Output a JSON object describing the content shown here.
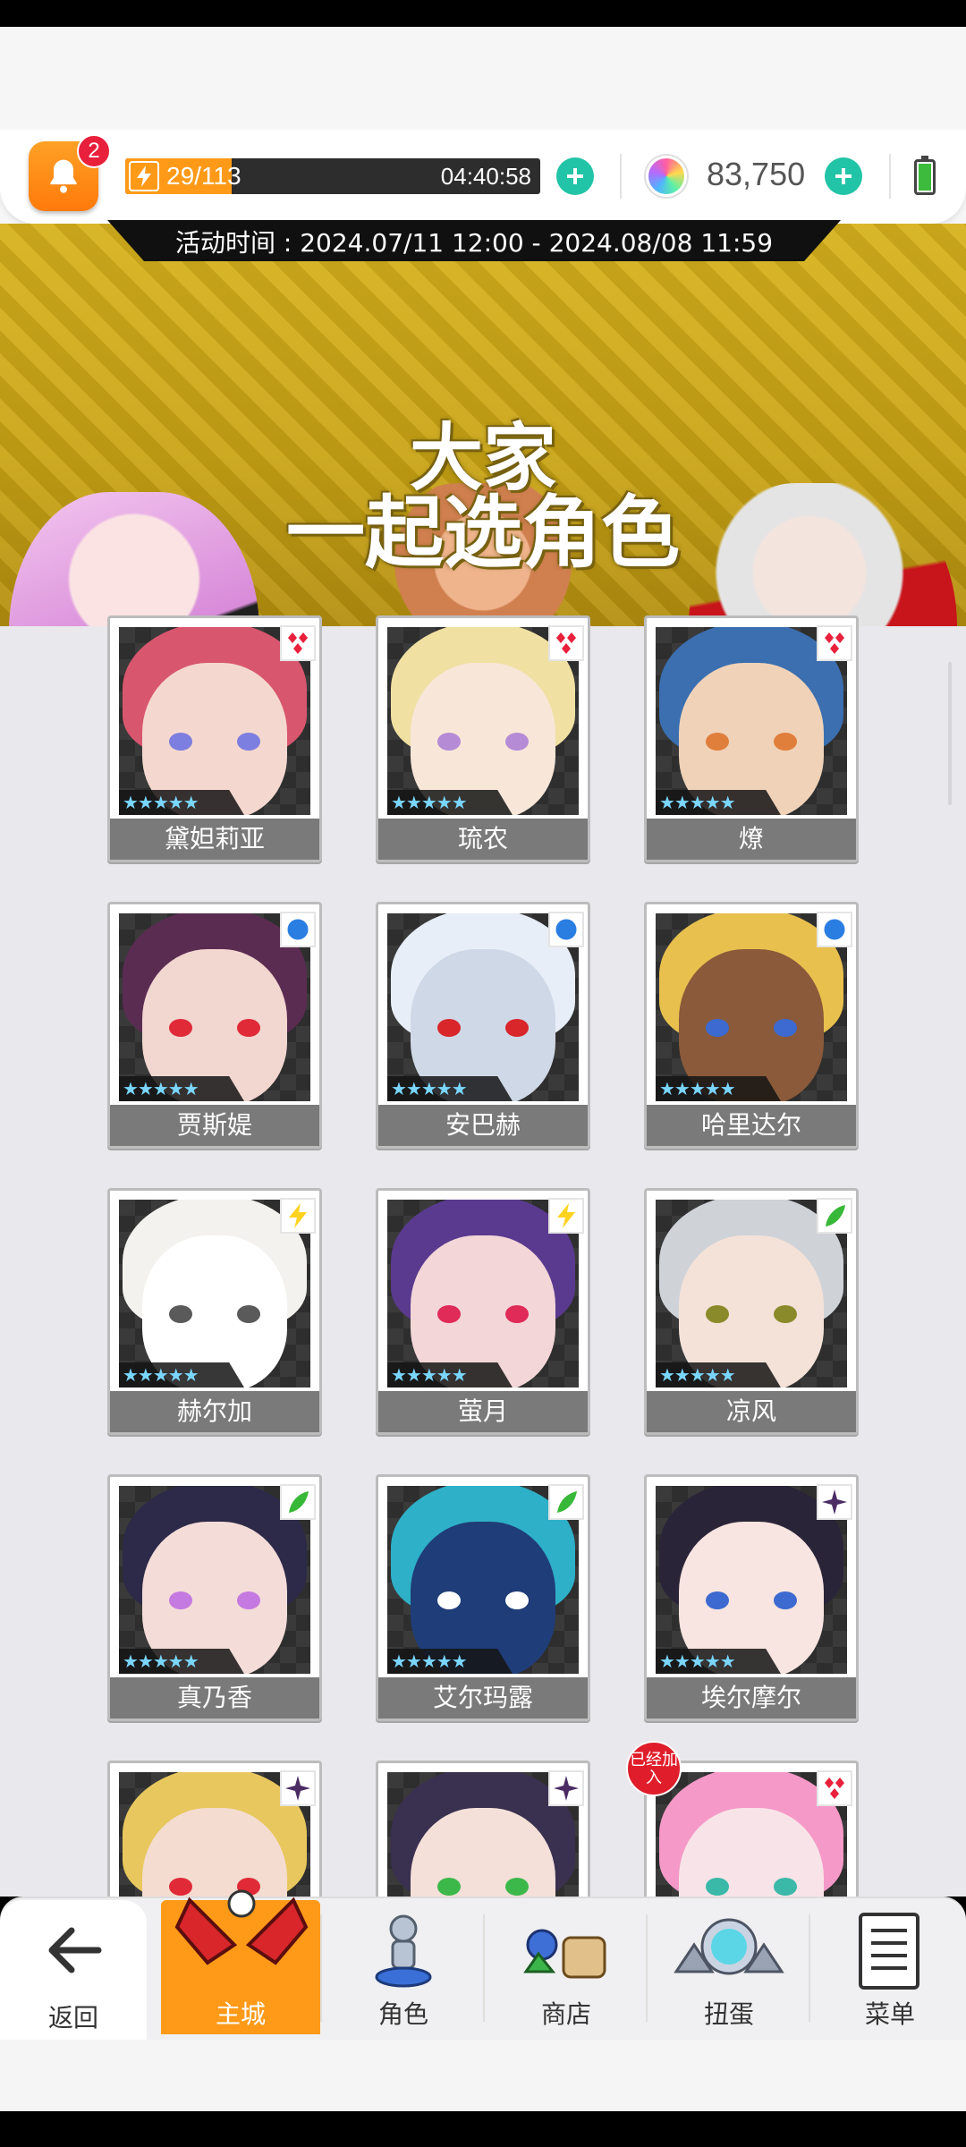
{
  "header": {
    "notification_count": "2",
    "stamina_value": "29/113",
    "stamina_fraction": 0.256,
    "stamina_timer": "04:40:58",
    "gems": "83,750"
  },
  "banner": {
    "event_time": "活动时间 : 2024.07/11 12:00 - 2024.08/08 11:59",
    "title_line1": "大家",
    "title_line2": "一起选角色"
  },
  "characters": [
    {
      "name": "黛妲莉亚",
      "element": "diamond",
      "stars": "★★★★★"
    },
    {
      "name": "琉农",
      "element": "diamond",
      "stars": "★★★★★"
    },
    {
      "name": "燎",
      "element": "diamond",
      "stars": "★★★★★"
    },
    {
      "name": "贾斯媞",
      "element": "circle",
      "stars": "★★★★★"
    },
    {
      "name": "安巴赫",
      "element": "circle",
      "stars": "★★★★★"
    },
    {
      "name": "哈里达尔",
      "element": "circle",
      "stars": "★★★★★"
    },
    {
      "name": "赫尔加",
      "element": "lightning",
      "stars": "★★★★★"
    },
    {
      "name": "萤月",
      "element": "lightning",
      "stars": "★★★★★"
    },
    {
      "name": "凉风",
      "element": "leaf",
      "stars": "★★★★★"
    },
    {
      "name": "真乃香",
      "element": "leaf",
      "stars": "★★★★★"
    },
    {
      "name": "艾尔玛露",
      "element": "leaf",
      "stars": "★★★★★"
    },
    {
      "name": "埃尔摩尔",
      "element": "star",
      "stars": "★★★★★"
    },
    {
      "name": "",
      "element": "star",
      "stars": ""
    },
    {
      "name": "",
      "element": "star",
      "stars": ""
    },
    {
      "name": "",
      "element": "diamond",
      "stars": "",
      "joined_badge": "已经加入"
    }
  ],
  "nav": {
    "back": "返回",
    "home": "主城",
    "characters": "角色",
    "shop": "商店",
    "gacha": "扭蛋",
    "menu": "菜单"
  },
  "colors": {
    "accent_orange": "#ff9a18",
    "plus_teal": "#21c4a6",
    "element_red": "#e8203c",
    "element_blue": "#2a7de1",
    "element_yellow": "#ffd21f",
    "element_green": "#38b838",
    "element_purple": "#4b2c63"
  }
}
